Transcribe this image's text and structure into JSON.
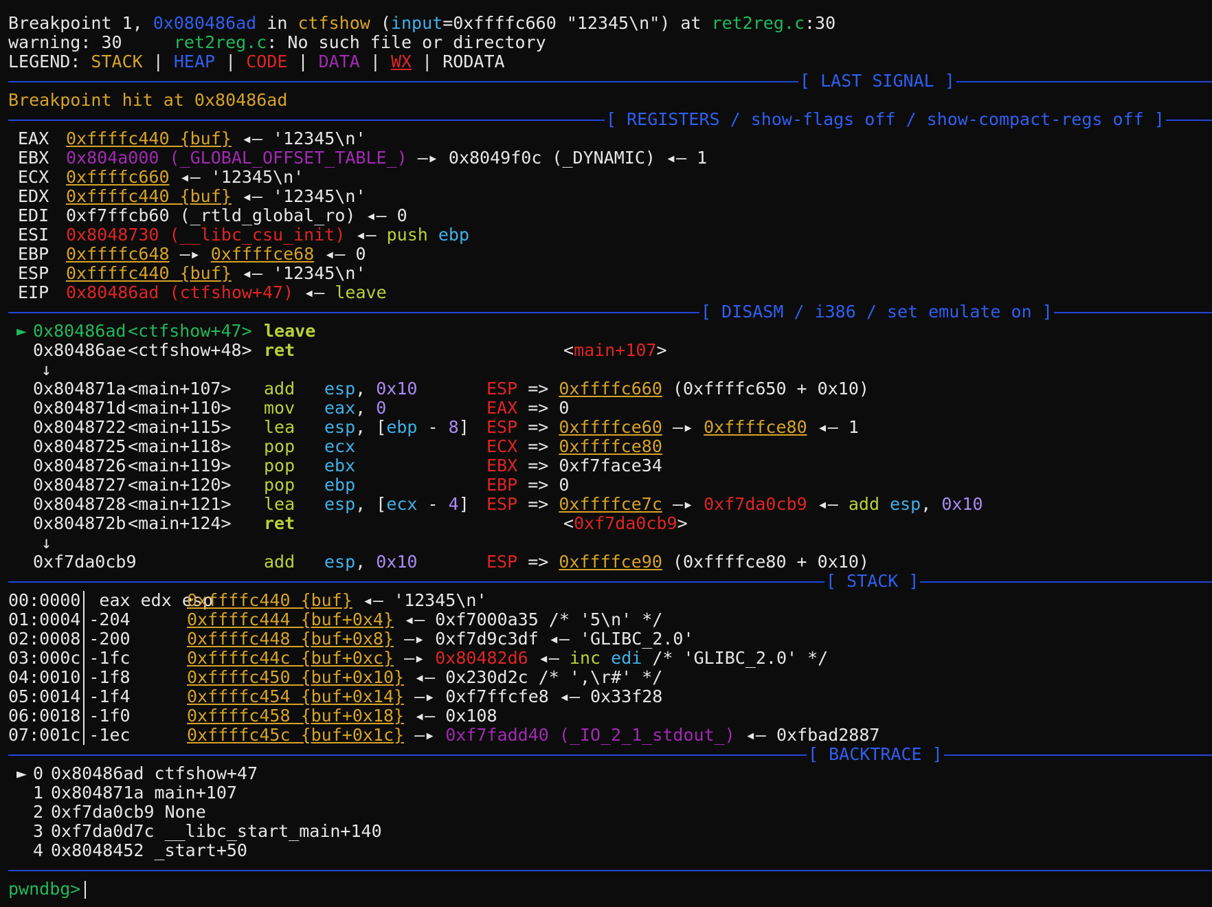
{
  "header": {
    "l1": {
      "a": "Breakpoint 1, ",
      "addr": "0x080486ad",
      "b": " in ",
      "func": "ctfshow",
      "c": " (",
      "arg": "input",
      "d": "=0xffffc660 \"12345\\n\") at ",
      "file": "ret2reg.c",
      "e": ":30"
    },
    "l2": {
      "a": "warning: 30     ",
      "file": "ret2reg.c",
      "b": ": No such file or directory"
    },
    "legend": {
      "label": "LEGEND: ",
      "stack": "STACK",
      "sep": " | ",
      "heap": "HEAP",
      "code": "CODE",
      "data": "DATA",
      "wx": "WX",
      "rodata": "RODATA"
    }
  },
  "sections": {
    "last_signal": "[ LAST SIGNAL ]",
    "registers": "[ REGISTERS / show-flags off / show-compact-regs off ]",
    "disasm": "[ DISASM / i386 / set emulate on ]",
    "stack": "[ STACK ]",
    "backtrace": "[ BACKTRACE ]"
  },
  "signal_text": "Breakpoint hit at 0x80486ad",
  "registers": {
    "eax": {
      "name": "EAX",
      "v": "0xffffc440 {buf}",
      "rest": " ◂— '12345\\n'"
    },
    "ebx": {
      "name": "EBX",
      "v": "0x804a000 (_GLOBAL_OFFSET_TABLE_)",
      "rest": " —▸ 0x8049f0c (_DYNAMIC) ◂— 1"
    },
    "ecx": {
      "name": "ECX",
      "v": "0xffffc660",
      "rest": " ◂— '12345\\n'"
    },
    "edx": {
      "name": "EDX",
      "v": "0xffffc440 {buf}",
      "rest": " ◂— '12345\\n'"
    },
    "edi": {
      "name": "EDI",
      "v": "0xf7ffcb60 (_rtld_global_ro)",
      "rest": " ◂— 0"
    },
    "esi": {
      "name": "ESI",
      "v": "0x8048730 (__libc_csu_init)",
      "rest": " ◂— ",
      "ins": "push",
      "op": " ebp"
    },
    "ebp": {
      "name": "EBP",
      "v": "0xffffc648",
      "arrow": " —▸ ",
      "v2": "0xffffce68",
      "rest": " ◂— 0"
    },
    "esp": {
      "name": "ESP",
      "v": "0xffffc440 {buf}",
      "rest": " ◂— '12345\\n'"
    },
    "eip": {
      "name": "EIP",
      "v": "0x80486ad (ctfshow+47)",
      "rest": " ◂— ",
      "ins": "leave"
    }
  },
  "disasm": {
    "marker": "►",
    "down_arrow": "↓",
    "r1": {
      "addr": "0x80486ad",
      "sym": "<ctfshow+47>",
      "ins": "leave"
    },
    "r2": {
      "addr": "0x80486ae",
      "sym": "<ctfshow+48>",
      "ins": "ret",
      "target_l": "<",
      "target": "main+107",
      "target_r": ">"
    },
    "r3": {
      "addr": "0x804871a",
      "sym": "<main+107>",
      "ins": "add",
      "op1": "esp",
      "comma": ", ",
      "op2": "0x10",
      "reg": "ESP",
      "eq": " => ",
      "v": "0xffffc660",
      "tail": " (0xffffc650 + 0x10)"
    },
    "r4": {
      "addr": "0x804871d",
      "sym": "<main+110>",
      "ins": "mov",
      "op1": "eax",
      "comma": ", ",
      "op2": "0",
      "reg": "EAX",
      "eq": " => ",
      "tail": "0"
    },
    "r5": {
      "addr": "0x8048722",
      "sym": "<main+115>",
      "ins": "lea",
      "op1": "esp",
      "comma": ", ",
      "lb": "[",
      "r": "ebp",
      "minus": " - ",
      "n": "8",
      "rb": "]",
      "reg": "ESP",
      "eq": " => ",
      "v": "0xffffce60",
      "arrow": " —▸ ",
      "v2": "0xffffce80",
      "tail": " ◂— 1"
    },
    "r6": {
      "addr": "0x8048725",
      "sym": "<main+118>",
      "ins": "pop",
      "op1": "ecx",
      "reg": "ECX",
      "eq": " => ",
      "v": "0xffffce80"
    },
    "r7": {
      "addr": "0x8048726",
      "sym": "<main+119>",
      "ins": "pop",
      "op1": "ebx",
      "reg": "EBX",
      "eq": " => ",
      "tail": "0xf7face34"
    },
    "r8": {
      "addr": "0x8048727",
      "sym": "<main+120>",
      "ins": "pop",
      "op1": "ebp",
      "reg": "EBP",
      "eq": " => ",
      "tail": "0"
    },
    "r9": {
      "addr": "0x8048728",
      "sym": "<main+121>",
      "ins": "lea",
      "op1": "esp",
      "comma": ", ",
      "lb": "[",
      "r": "ecx",
      "minus": " - ",
      "n": "4",
      "rb": "]",
      "reg": "ESP",
      "eq": " => ",
      "v": "0xffffce7c",
      "arrow": " —▸ ",
      "v2": "0xf7da0cb9",
      "tail": " ◂— ",
      "tins": "add",
      "tr": " esp",
      "tc": ", ",
      "tn": "0x10"
    },
    "r10": {
      "addr": "0x804872b",
      "sym": "<main+124>",
      "ins": "ret",
      "target_l": "<",
      "target": "0xf7da0cb9",
      "target_r": ">"
    },
    "r11": {
      "addr": "0xf7da0cb9",
      "ins": "add",
      "op1": "esp",
      "comma": ", ",
      "op2": "0x10",
      "reg": "ESP",
      "eq": " => ",
      "v": "0xffffce90",
      "tail": " (0xffffce80 + 0x10)"
    }
  },
  "stack": [
    {
      "idx": "00:0000",
      "off": " eax edx esp",
      "addr": "0xffffc440 {buf}",
      "rest": " ◂— '12345\\n'"
    },
    {
      "idx": "01:0004",
      "off": "-204",
      "addr": "0xffffc444 {buf+0x4}",
      "rest": " ◂— 0xf7000a35 /* '5\\n' */"
    },
    {
      "idx": "02:0008",
      "off": "-200",
      "addr": "0xffffc448 {buf+0x8}",
      "rest": " —▸ 0xf7d9c3df ◂— 'GLIBC_2.0'"
    },
    {
      "idx": "03:000c",
      "off": "-1fc",
      "addr": "0xffffc44c {buf+0xc}",
      "arrow": " —▸ ",
      "red": "0x80482d6",
      "rest2": " ◂— ",
      "ins": "inc",
      "op": " edi",
      "tail": " /* 'GLIBC_2.0' */"
    },
    {
      "idx": "04:0010",
      "off": "-1f8",
      "addr": "0xffffc450 {buf+0x10}",
      "rest": " ◂— 0x230d2c /* ',\\r#' */"
    },
    {
      "idx": "05:0014",
      "off": "-1f4",
      "addr": "0xffffc454 {buf+0x14}",
      "rest": " —▸ 0xf7ffcfe8 ◂— 0x33f28"
    },
    {
      "idx": "06:0018",
      "off": "-1f0",
      "addr": "0xffffc458 {buf+0x18}",
      "rest": " ◂— 0x108"
    },
    {
      "idx": "07:001c",
      "off": "-1ec",
      "addr": "0xffffc45c {buf+0x1c}",
      "arrow": " —▸ ",
      "mag": "0xf7fadd40 (_IO_2_1_stdout_)",
      "rest2": " ◂— 0xfbad2887"
    }
  ],
  "backtrace": [
    {
      "m": "►",
      "n": "0",
      "text": "0x80486ad ctfshow+47"
    },
    {
      "m": " ",
      "n": "1",
      "text": "0x804871a main+107"
    },
    {
      "m": " ",
      "n": "2",
      "text": "0xf7da0cb9 None"
    },
    {
      "m": " ",
      "n": "3",
      "text": "0xf7da0d7c __libc_start_main+140"
    },
    {
      "m": " ",
      "n": "4",
      "text": "0x8048452 _start+50"
    }
  ],
  "prompt": "pwndbg>"
}
